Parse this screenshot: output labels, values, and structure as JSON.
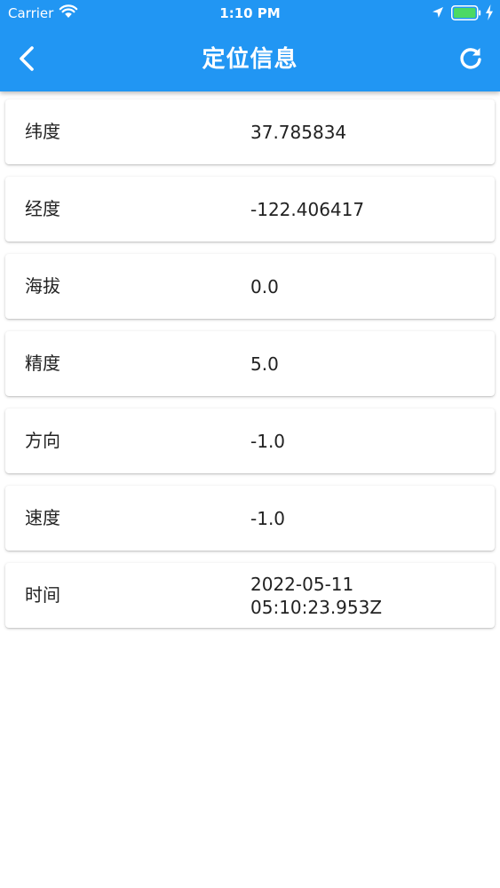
{
  "status_bar": {
    "carrier": "Carrier",
    "time": "1:10 PM",
    "icons": [
      "wifi-icon",
      "location-arrow-icon",
      "battery-icon",
      "charging-bolt-icon"
    ],
    "battery_color": "#4cd964"
  },
  "app_bar": {
    "title": "定位信息",
    "back_icon": "chevron-left-icon",
    "refresh_icon": "refresh-icon",
    "color": "#2196f3"
  },
  "items": [
    {
      "label": "纬度",
      "value": "37.785834"
    },
    {
      "label": "经度",
      "value": "-122.406417"
    },
    {
      "label": "海拔",
      "value": "0.0"
    },
    {
      "label": "精度",
      "value": "5.0"
    },
    {
      "label": "方向",
      "value": "-1.0"
    },
    {
      "label": "速度",
      "value": "-1.0"
    },
    {
      "label": "时间",
      "value": "2022-05-11\n05:10:23.953Z"
    }
  ]
}
